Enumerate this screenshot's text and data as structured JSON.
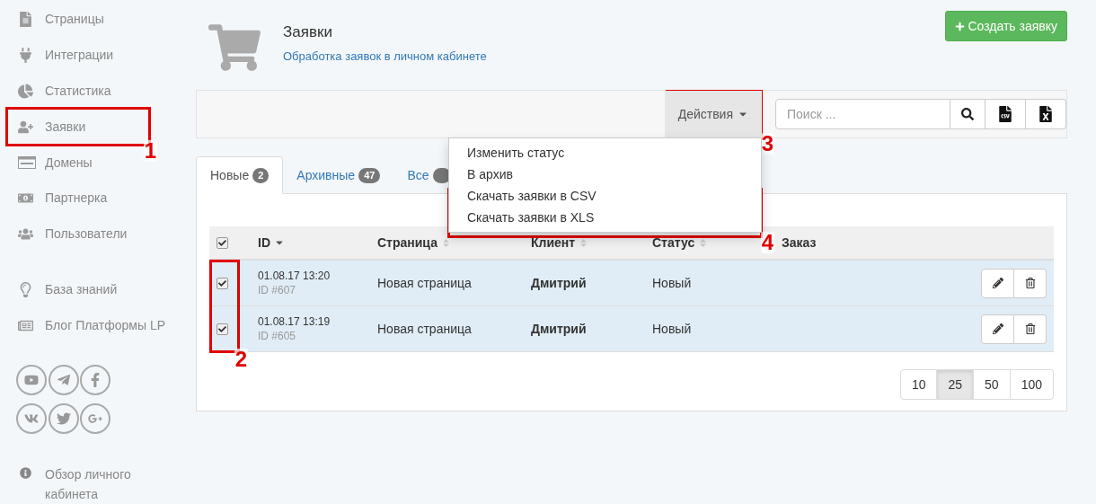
{
  "sidebar": {
    "items": [
      "Страницы",
      "Интеграции",
      "Статистика",
      "Заявки",
      "Домены",
      "Партнерка",
      "Пользователи"
    ],
    "extra_items": [
      "База знаний",
      "Блог Платформы LP"
    ],
    "footer_link": "Обзор личного кабинета"
  },
  "header": {
    "title": "Заявки",
    "subtitle": "Обработка заявок в личном кабинете",
    "create_button": "Создать заявку"
  },
  "toolbar": {
    "actions_button": "Действия",
    "search": {
      "placeholder": "Поиск ..."
    }
  },
  "actions_menu": [
    "Изменить статус",
    "В архив",
    "Скачать заявки в CSV",
    "Скачать заявки в XLS"
  ],
  "tabs": [
    {
      "label": "Новые",
      "count": "2",
      "selected": true
    },
    {
      "label": "Архивные",
      "count": "47",
      "selected": false
    },
    {
      "label": "Все",
      "selected": false
    }
  ],
  "table": {
    "all_checked": true,
    "columns": [
      {
        "label": "ID",
        "sorted": true
      },
      {
        "label": "Страница",
        "sorted": false
      },
      {
        "label": "Клиент",
        "sorted": false
      },
      {
        "label": "Статус",
        "sorted": false
      },
      {
        "label": "Заказ"
      }
    ],
    "rows": [
      {
        "checked": true,
        "date": "01.08.17 13:20",
        "id": "ID #607",
        "page": "Новая страница",
        "client": "Дмитрий",
        "status": "Новый"
      },
      {
        "checked": true,
        "date": "01.08.17 13:19",
        "id": "ID #605",
        "page": "Новая страница",
        "client": "Дмитрий",
        "status": "Новый"
      }
    ]
  },
  "page_sizes": [
    {
      "label": "10",
      "selected": false
    },
    {
      "label": "25",
      "selected": true
    },
    {
      "label": "50",
      "selected": false
    },
    {
      "label": "100",
      "selected": false
    }
  ],
  "annotations": [
    "1",
    "2",
    "3",
    "4"
  ]
}
